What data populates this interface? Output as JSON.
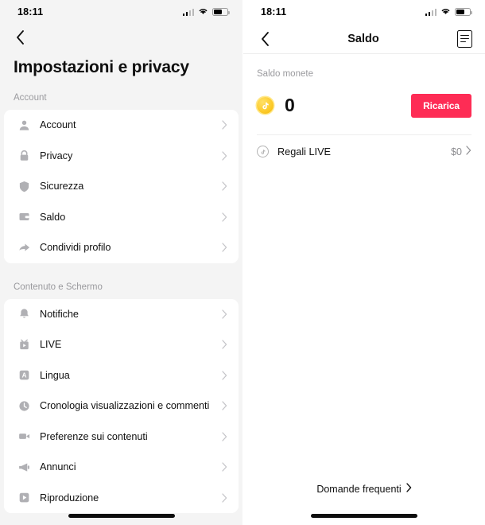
{
  "status_bar": {
    "time": "18:11",
    "icons": [
      "cellular-signal-icon",
      "wifi-icon",
      "battery-icon"
    ]
  },
  "colors": {
    "accent_red": "#FE2C55",
    "coin_yellow": "#FDCC2E",
    "page_bg": "#F4F4F4",
    "card_bg": "#FFFFFF",
    "muted_text": "#9A9A9E",
    "divider": "#EDEDED"
  },
  "left_screen": {
    "back_icon": "chevron-left-icon",
    "title": "Impostazioni e privacy",
    "sections": [
      {
        "label": "Account",
        "items": [
          {
            "icon": "person-icon",
            "label": "Account",
            "chevron": "chevron-right-icon"
          },
          {
            "icon": "lock-icon",
            "label": "Privacy",
            "chevron": "chevron-right-icon"
          },
          {
            "icon": "shield-icon",
            "label": "Sicurezza",
            "chevron": "chevron-right-icon"
          },
          {
            "icon": "wallet-icon",
            "label": "Saldo",
            "chevron": "chevron-right-icon"
          },
          {
            "icon": "share-icon",
            "label": "Condividi profilo",
            "chevron": "chevron-right-icon"
          }
        ]
      },
      {
        "label": "Contenuto e Schermo",
        "items": [
          {
            "icon": "bell-icon",
            "label": "Notifiche",
            "chevron": "chevron-right-icon"
          },
          {
            "icon": "live-icon",
            "label": "LIVE",
            "chevron": "chevron-right-icon"
          },
          {
            "icon": "language-icon",
            "label": "Lingua",
            "chevron": "chevron-right-icon"
          },
          {
            "icon": "clock-icon",
            "label": "Cronologia visualizzazioni e commenti",
            "chevron": "chevron-right-icon"
          },
          {
            "icon": "video-icon",
            "label": "Preferenze sui contenuti",
            "chevron": "chevron-right-icon"
          },
          {
            "icon": "megaphone-icon",
            "label": "Annunci",
            "chevron": "chevron-right-icon"
          },
          {
            "icon": "play-icon",
            "label": "Riproduzione",
            "chevron": "chevron-right-icon"
          }
        ]
      }
    ]
  },
  "right_screen": {
    "back_icon": "chevron-left-icon",
    "title": "Saldo",
    "menu_icon": "transaction-history-icon",
    "coin_balance_label": "Saldo monete",
    "coin_icon": "tiktok-coin-icon",
    "coin_balance_value": "0",
    "recharge_button": "Ricarica",
    "gift_row": {
      "icon": "tiktok-note-circle-icon",
      "label": "Regali LIVE",
      "value": "$0",
      "chevron": "chevron-right-icon"
    },
    "faq_link": "Domande frequenti",
    "faq_chevron": "chevron-right-icon"
  }
}
